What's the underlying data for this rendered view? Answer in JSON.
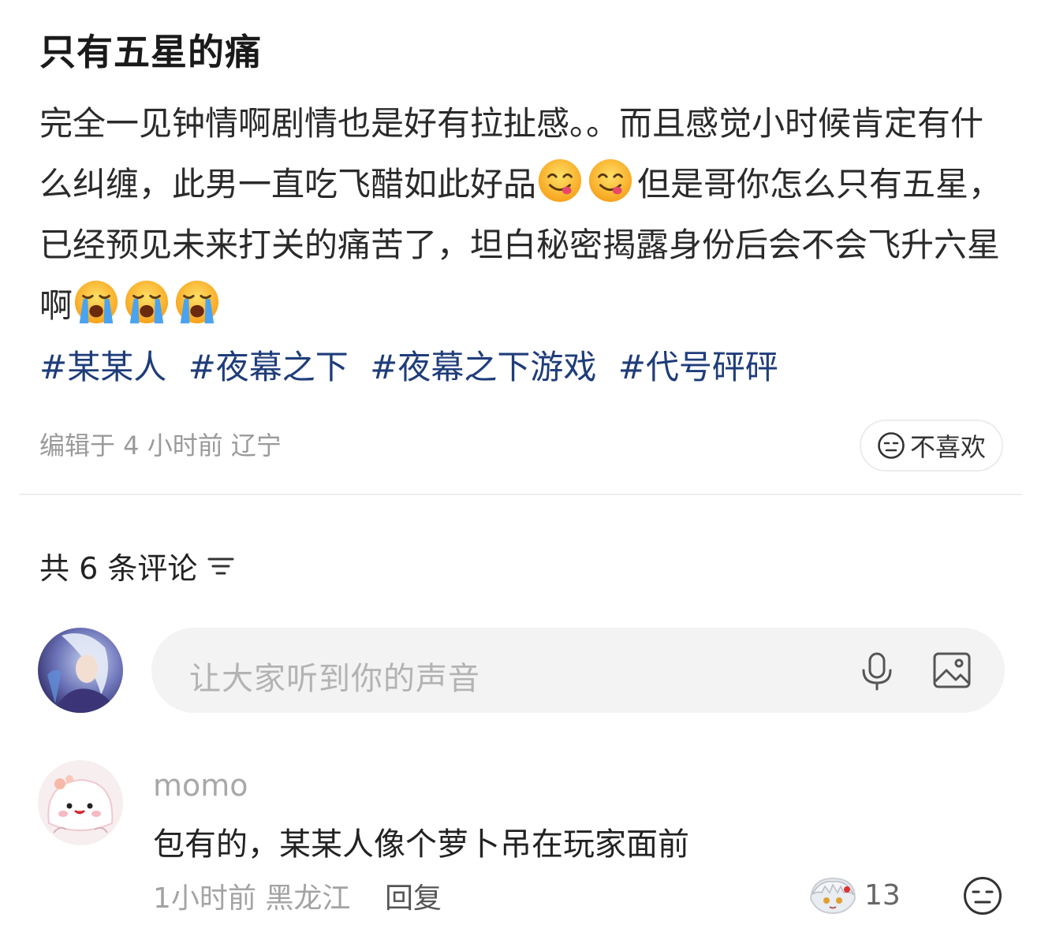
{
  "post": {
    "title": "只有五星的痛",
    "body": {
      "seg1": "完全一见钟情啊剧情也是好有拉扯感。。而且感觉小时候肯定有什么纠缠，此男一直吃飞醋如此好品",
      "seg2": "但是哥你怎么只有五星，已经预见未来打关的痛苦了，坦白秘密揭露身份后会不会飞升六星啊"
    },
    "emojis": {
      "after_seg1": [
        "yum-face-icon",
        "yum-face-icon"
      ],
      "after_seg2": [
        "loudly-crying-face-icon",
        "loudly-crying-face-icon",
        "loudly-crying-face-icon"
      ]
    },
    "tags": [
      "#某某人",
      "#夜幕之下",
      "#夜幕之下游戏",
      "#代号砰砰"
    ],
    "meta": "编辑于 4 小时前 辽宁",
    "dislike_label": "不喜欢"
  },
  "comments_section": {
    "count_label": "共 6 条评论",
    "sort_icon": "sort-lines-icon",
    "input": {
      "placeholder": "让大家听到你的声音",
      "mic_icon": "microphone-icon",
      "image_icon": "image-icon"
    }
  },
  "comments": [
    {
      "user": "momo",
      "text": "包有的，某某人像个萝卜吊在玩家面前",
      "meta": "1小时前 黑龙江",
      "reply_label": "回复",
      "like_count": "13",
      "like_icon": "character-sticker-icon",
      "dislike_icon": "meh-face-icon"
    }
  ],
  "colors": {
    "tag": "#1f3d7a",
    "muted": "#9a9a9a",
    "input_bg": "#f3f3f3"
  }
}
